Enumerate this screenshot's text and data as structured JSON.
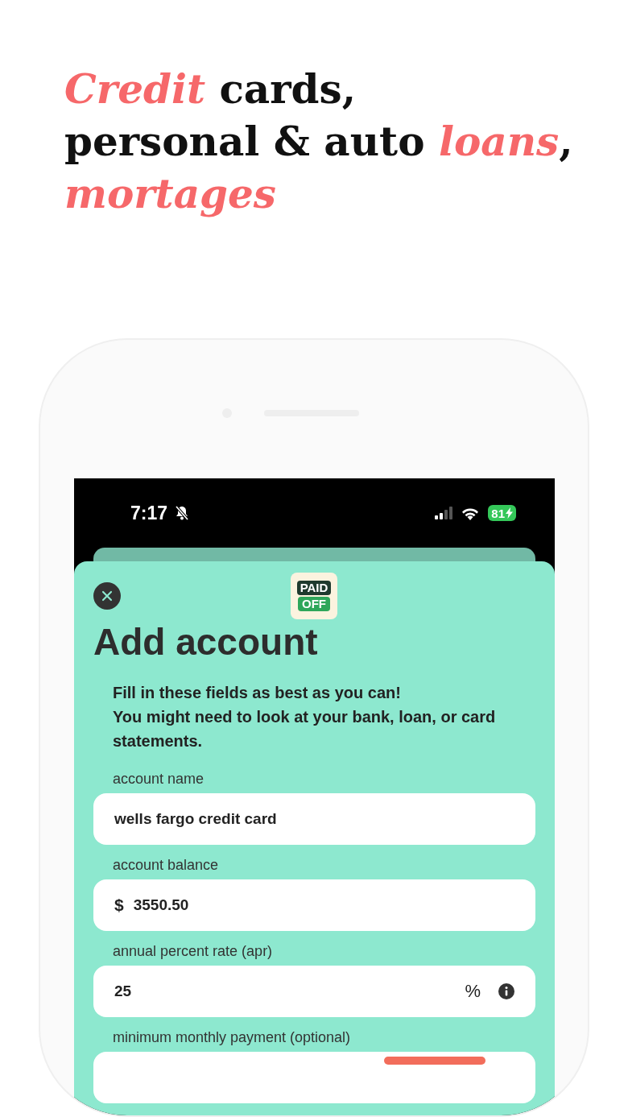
{
  "headline": {
    "lines": [
      [
        {
          "text": "Credit",
          "accent": true
        },
        {
          "text": " cards,",
          "accent": false
        }
      ],
      [
        {
          "text": "personal & auto ",
          "accent": false
        },
        {
          "text": "loans",
          "accent": true
        },
        {
          "text": ",",
          "accent": false
        }
      ],
      [
        {
          "text": "mortages",
          "accent": true
        }
      ]
    ]
  },
  "status_bar": {
    "time": "7:17",
    "silenced": true,
    "battery": "81",
    "charging": true
  },
  "sheet": {
    "logo": {
      "top": "PAID",
      "bottom": "OFF"
    },
    "title": "Add account",
    "intro": [
      "Fill in these fields as best as you can!",
      "You might need to look at your bank, loan, or card statements."
    ],
    "fields": [
      {
        "label": "account name",
        "value": "wells fargo credit card"
      },
      {
        "label": "account balance",
        "prefix": "$",
        "value": "3550.50"
      },
      {
        "label": "annual percent rate (apr)",
        "value": "25",
        "suffix": "%",
        "info": true
      },
      {
        "label": "minimum monthly payment (optional)",
        "action_button": true
      }
    ]
  }
}
